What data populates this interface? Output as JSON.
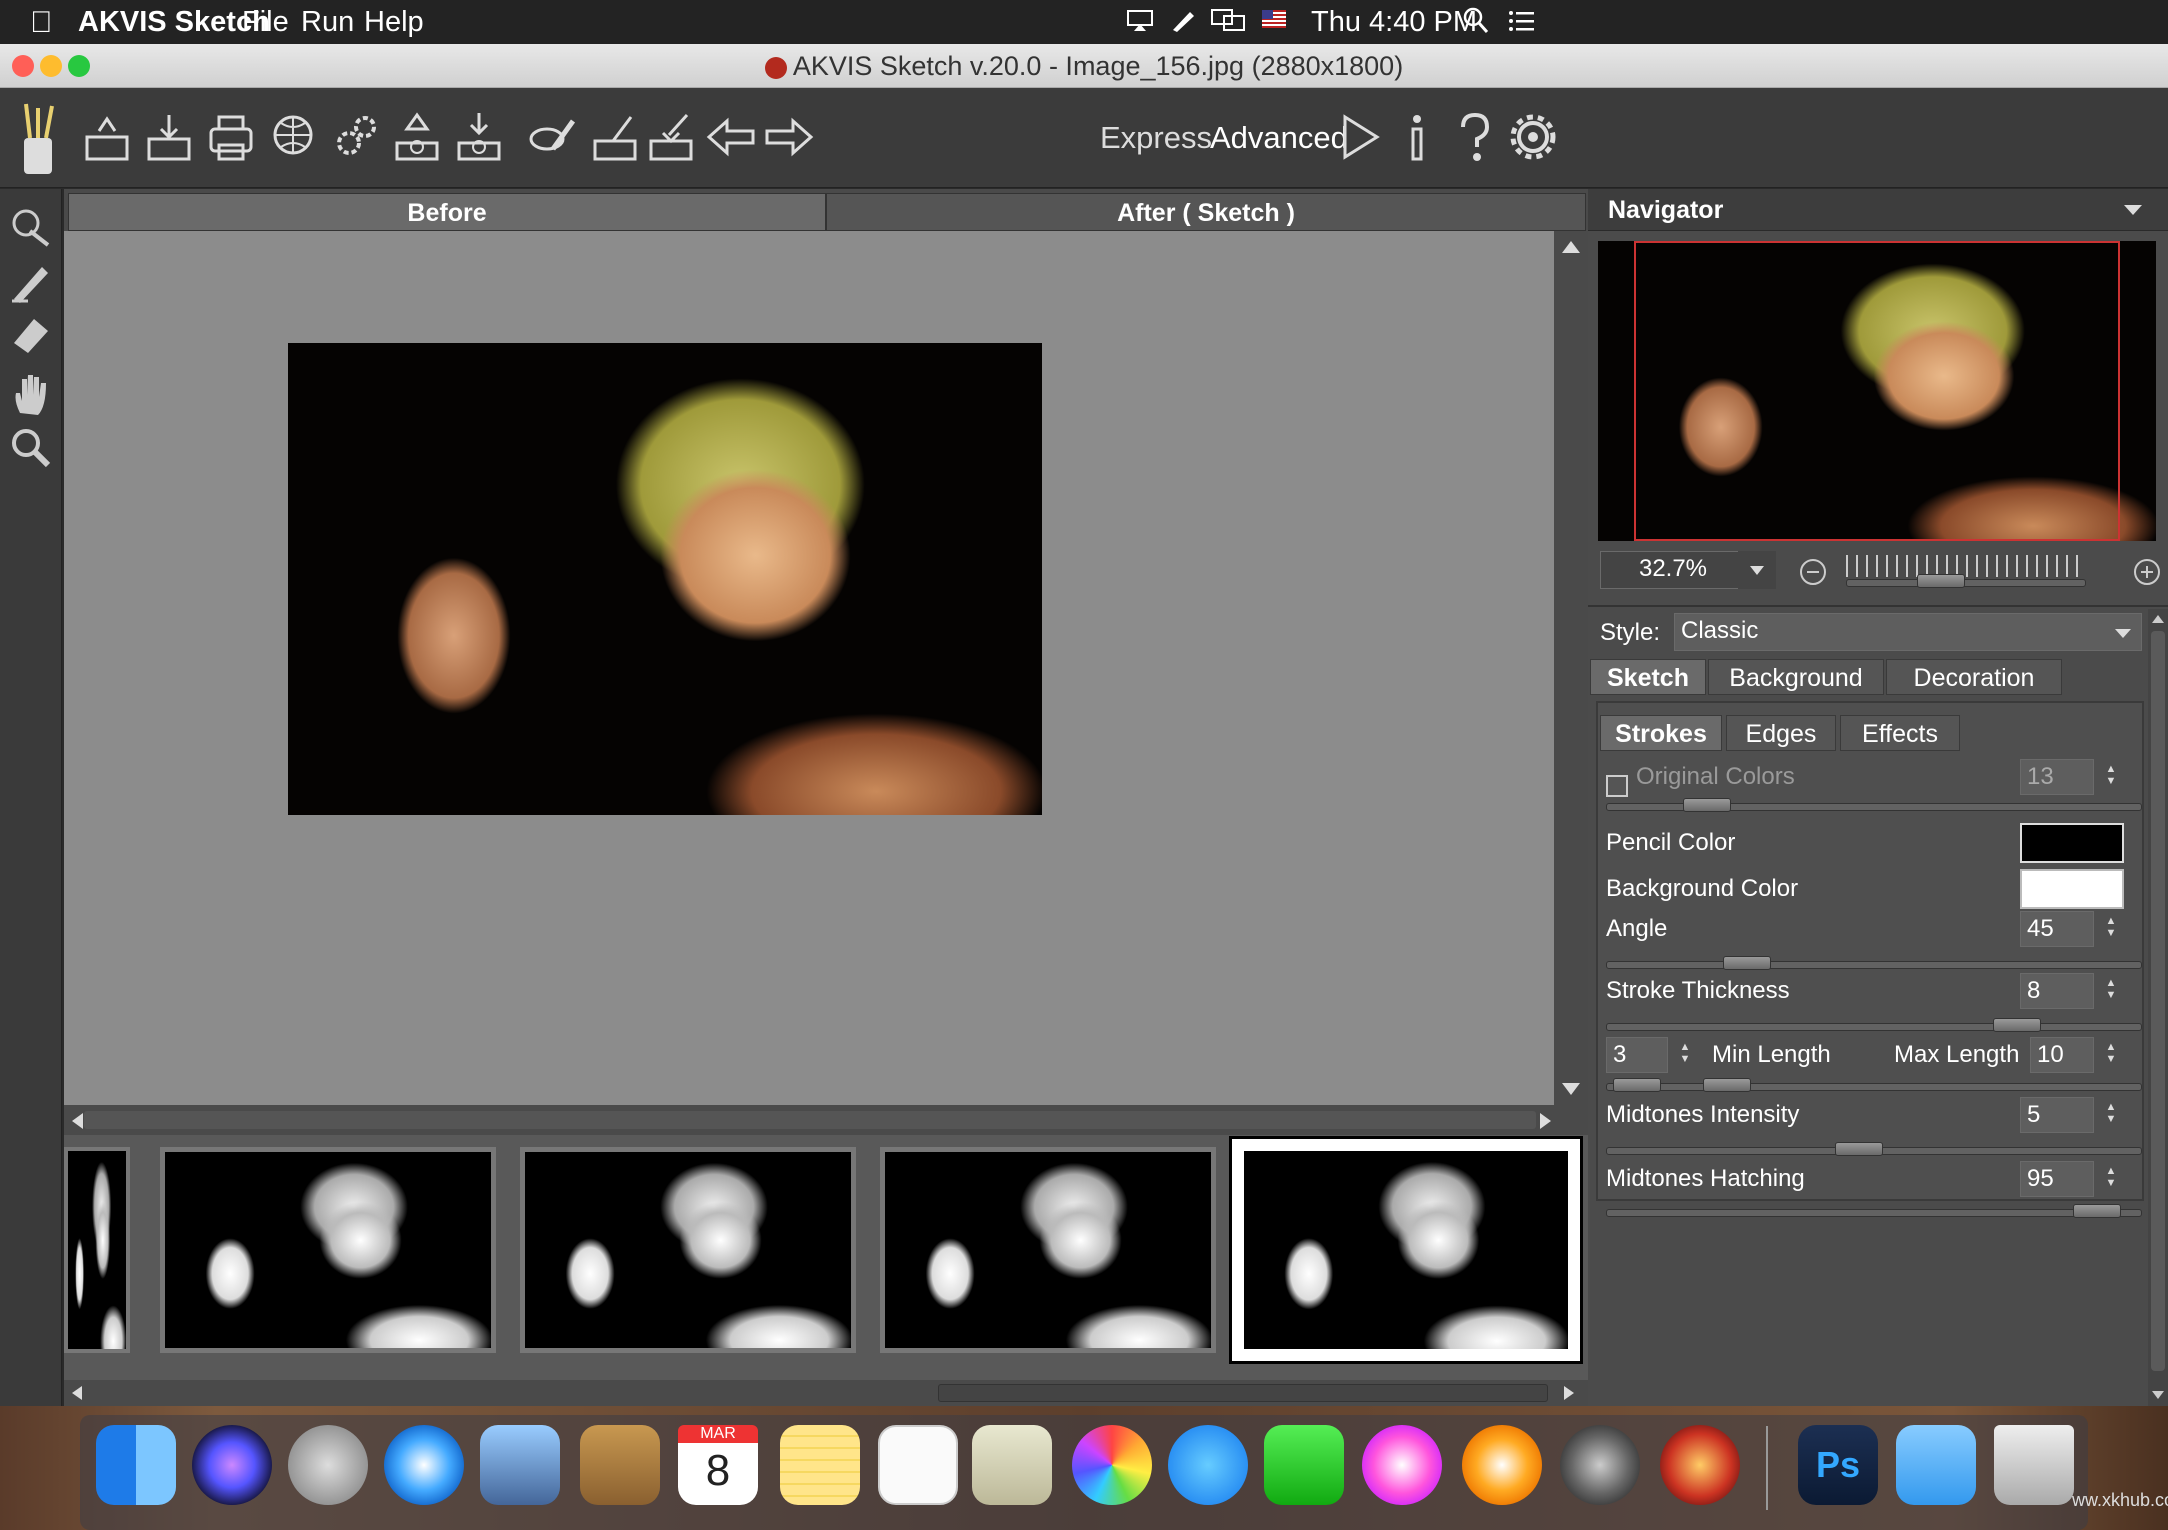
{
  "menubar": {
    "app_name": "AKVIS Sketch",
    "items": [
      "File",
      "Run",
      "Help"
    ],
    "clock": "Thu 4:40 PM"
  },
  "window": {
    "title": "AKVIS Sketch v.20.0 - Image_156.jpg (2880x1800)"
  },
  "toolbar": {
    "express_label": "Express",
    "advanced_label": "Advanced"
  },
  "view_tabs": {
    "before": "Before",
    "after": "After ( Sketch )"
  },
  "navigator": {
    "title": "Navigator",
    "zoom": "32.7%"
  },
  "settings": {
    "style_label": "Style:",
    "style_value": "Classic",
    "tabs": [
      "Sketch",
      "Background",
      "Decoration"
    ],
    "subtabs": [
      "Strokes",
      "Edges",
      "Effects"
    ],
    "original_colors_label": "Original Colors",
    "original_colors_value": "13",
    "original_colors_checked": false,
    "pencil_color_label": "Pencil Color",
    "pencil_color": "#000000",
    "background_color_label": "Background Color",
    "background_color": "#ffffff",
    "angle_label": "Angle",
    "angle_value": "45",
    "stroke_thickness_label": "Stroke Thickness",
    "stroke_thickness_value": "8",
    "min_length_value": "3",
    "min_length_label": "Min Length",
    "max_length_label": "Max Length",
    "max_length_value": "10",
    "midtones_intensity_label": "Midtones Intensity",
    "midtones_intensity_value": "5",
    "midtones_hatching_label": "Midtones Hatching",
    "midtones_hatching_value": "95"
  },
  "dock": {
    "calendar_month": "MAR",
    "calendar_day": "8",
    "ps_label": "Ps"
  },
  "watermark": "ww.xkhub.com",
  "colors": {
    "accent_close": "#ff5f57",
    "accent_min": "#febc2e",
    "accent_max": "#28c840"
  }
}
